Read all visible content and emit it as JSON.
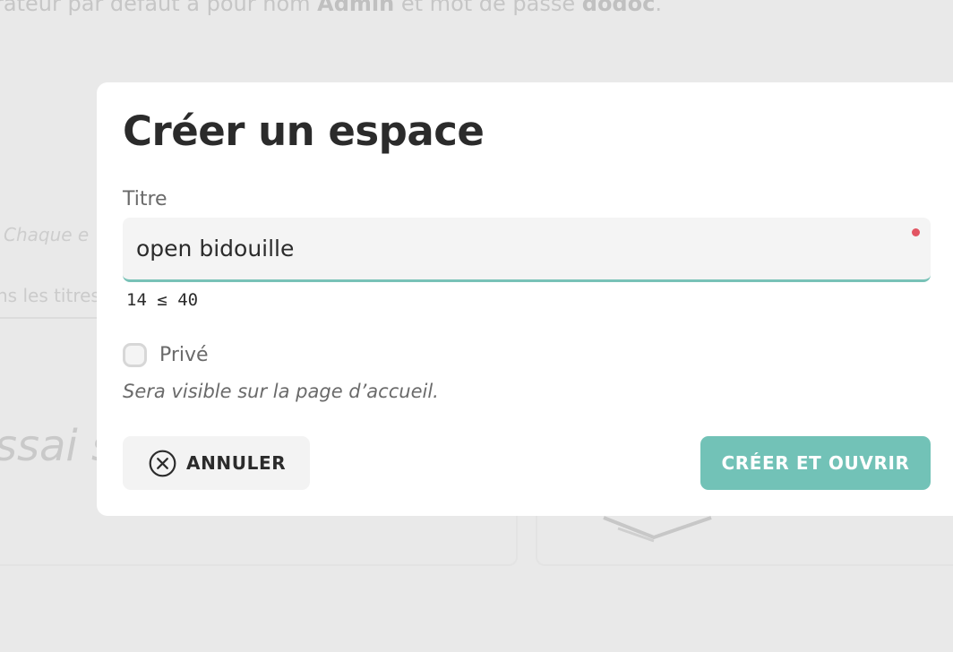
{
  "background": {
    "intro_prefix": "rateur par défaut a pour nom ",
    "intro_admin": "Admin",
    "intro_middle": " et mot de passe ",
    "intro_password": "dodoc",
    "intro_suffix": ".",
    "hint": "Chaque e",
    "filter": "ns les titres",
    "card_title": "ssai st"
  },
  "modal": {
    "title": "Créer un espace",
    "title_field": {
      "label": "Titre",
      "value": "open bidouille",
      "counter": "14 ≤ 40",
      "required": true
    },
    "private": {
      "label": "Privé",
      "checked": false,
      "description": "Sera visible sur la page d’accueil."
    },
    "cancel_label": "ANNULER",
    "cancel_icon": "close-circle-icon",
    "create_label": "CRÉER ET OUVRIR"
  },
  "colors": {
    "accent": "#72c2b7",
    "required_dot": "#e25563",
    "overlay": "#e9e9e9"
  }
}
